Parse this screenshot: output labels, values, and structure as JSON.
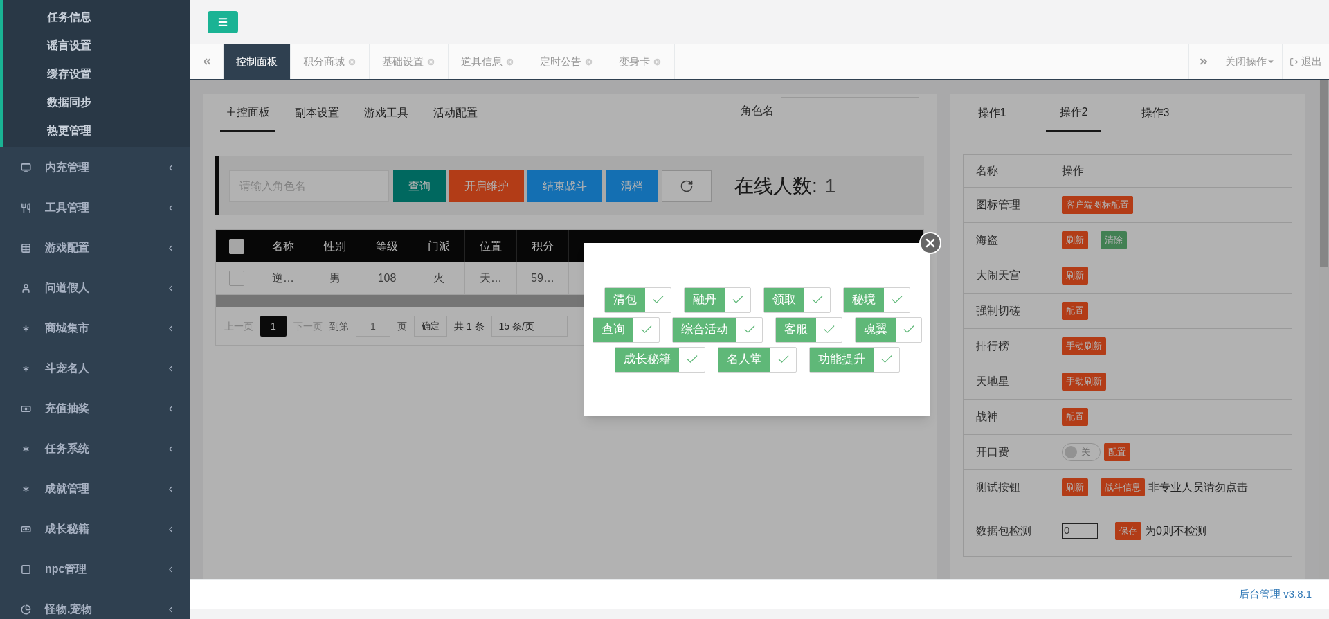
{
  "sidebar": {
    "submenu": [
      {
        "label": "任务信息"
      },
      {
        "label": "谣言设置"
      },
      {
        "label": "缓存设置"
      },
      {
        "label": "数据同步"
      },
      {
        "label": "热更管理"
      }
    ],
    "items": [
      {
        "label": "内充管理"
      },
      {
        "label": "工具管理"
      },
      {
        "label": "游戏配置"
      },
      {
        "label": "问道假人"
      },
      {
        "label": "商城集市"
      },
      {
        "label": "斗宠名人"
      },
      {
        "label": "充值抽奖"
      },
      {
        "label": "任务系统"
      },
      {
        "label": "成就管理"
      },
      {
        "label": "成长秘籍"
      },
      {
        "label": "npc管理"
      },
      {
        "label": "怪物.宠物"
      }
    ]
  },
  "page_tabs": [
    {
      "label": "控制面板",
      "selected": true,
      "closable": false
    },
    {
      "label": "积分商城",
      "selected": false,
      "closable": true
    },
    {
      "label": "基础设置",
      "selected": false,
      "closable": true
    },
    {
      "label": "道具信息",
      "selected": false,
      "closable": true
    },
    {
      "label": "定时公告",
      "selected": false,
      "closable": true
    },
    {
      "label": "变身卡",
      "selected": false,
      "closable": true
    }
  ],
  "close_menu": "关闭操作",
  "logout": "退出",
  "main": {
    "tabs": [
      {
        "label": "主控面板",
        "selected": true
      },
      {
        "label": "副本设置",
        "selected": false
      },
      {
        "label": "游戏工具",
        "selected": false
      },
      {
        "label": "活动配置",
        "selected": false
      }
    ],
    "role_label": "角色名",
    "search": {
      "placeholder": "请输入角色名"
    },
    "buttons": [
      {
        "label": "查询",
        "kind": "query"
      },
      {
        "label": "开启维护",
        "kind": "warn"
      },
      {
        "label": "结束战斗",
        "kind": "normal"
      },
      {
        "label": "清档",
        "kind": "normal"
      }
    ],
    "online_label": "在线人数:",
    "online_count": "1",
    "table": {
      "all_checked": false,
      "columns": [
        "名称",
        "性别",
        "等级",
        "门派",
        "位置",
        "积分"
      ],
      "rows": [
        {
          "checked": false,
          "cells": [
            "逆…",
            "男",
            "108",
            "火",
            "天…",
            "59…"
          ]
        }
      ]
    },
    "pager": {
      "prev": "上一页",
      "page": "1",
      "next": "下一页",
      "goto": "到第",
      "goto_value": "1",
      "page_unit": "页",
      "confirm": "确定",
      "total": "共 1 条",
      "size": "15 条/页"
    }
  },
  "dialog": {
    "options": [
      [
        {
          "label": "清包",
          "checked": true
        },
        {
          "label": "融丹",
          "checked": true
        },
        {
          "label": "领取",
          "checked": true
        },
        {
          "label": "秘境",
          "checked": true
        }
      ],
      [
        {
          "label": "查询",
          "checked": true
        },
        {
          "label": "综合活动",
          "checked": true
        },
        {
          "label": "客服",
          "checked": true
        },
        {
          "label": "魂翼",
          "checked": true
        }
      ],
      [
        {
          "label": "成长秘籍",
          "checked": true
        },
        {
          "label": "名人堂",
          "checked": true
        },
        {
          "label": "功能提升",
          "checked": true
        }
      ]
    ]
  },
  "ops": {
    "tabs": [
      {
        "label": "操作1",
        "selected": false
      },
      {
        "label": "操作2",
        "selected": true
      },
      {
        "label": "操作3",
        "selected": false
      }
    ],
    "columns": [
      "名称",
      "操作"
    ],
    "rows": [
      {
        "name": "图标管理",
        "actions": [
          {
            "kind": "warn",
            "label": "客户端图标配置"
          }
        ]
      },
      {
        "name": "海盗",
        "actions": [
          {
            "kind": "warn",
            "label": "刷新"
          },
          {
            "kind": "ok",
            "label": "清除"
          }
        ]
      },
      {
        "name": "大闹天宫",
        "actions": [
          {
            "kind": "warn",
            "label": "刷新"
          }
        ]
      },
      {
        "name": "强制切磋",
        "actions": [
          {
            "kind": "warn",
            "label": "配置"
          }
        ]
      },
      {
        "name": "排行榜",
        "actions": [
          {
            "kind": "warn",
            "label": "手动刷新"
          }
        ]
      },
      {
        "name": "天地星",
        "actions": [
          {
            "kind": "warn",
            "label": "手动刷新"
          }
        ]
      },
      {
        "name": "战神",
        "actions": [
          {
            "kind": "warn",
            "label": "配置"
          }
        ]
      },
      {
        "name": "开口费",
        "actions": [
          {
            "kind": "switch",
            "label": "关",
            "on": false
          },
          {
            "kind": "warn",
            "label": "配置"
          }
        ]
      },
      {
        "name": "测试按钮",
        "actions": [
          {
            "kind": "warn",
            "label": "刷新"
          },
          {
            "kind": "warn",
            "label": "战斗信息"
          },
          {
            "kind": "text",
            "label": "非专业人员请勿点击"
          }
        ]
      },
      {
        "name": "数据包检测",
        "actions": [
          {
            "kind": "input",
            "value": "0"
          },
          {
            "kind": "warn",
            "label": "保存"
          },
          {
            "kind": "text",
            "label": "为0则不检测"
          }
        ]
      }
    ]
  },
  "footer": "后台管理 v3.8.1"
}
